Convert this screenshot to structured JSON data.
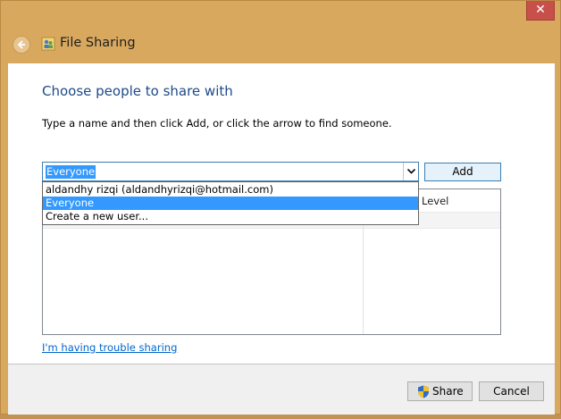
{
  "window": {
    "title": "File Sharing",
    "close_glyph": "✕",
    "accent_color": "#d9a85f",
    "close_color": "#c7504a"
  },
  "main": {
    "heading": "Choose people to share with",
    "instruction": "Type a name and then click Add, or click the arrow to find someone.",
    "combo_value": "Everyone",
    "add_label": "Add",
    "dropdown_items": [
      "aldandhy rizqi (aldandhyrizqi@hotmail.com)",
      "Everyone",
      "Create a new user..."
    ],
    "selected_index": 1,
    "permission_header": "Level",
    "trouble_link": "I'm having trouble sharing"
  },
  "footer": {
    "share_label": "Share",
    "cancel_label": "Cancel"
  },
  "icons": {
    "back": "back-arrow-icon",
    "app": "people-icon",
    "dropdown": "chevron-down-icon",
    "shield": "uac-shield-icon"
  }
}
